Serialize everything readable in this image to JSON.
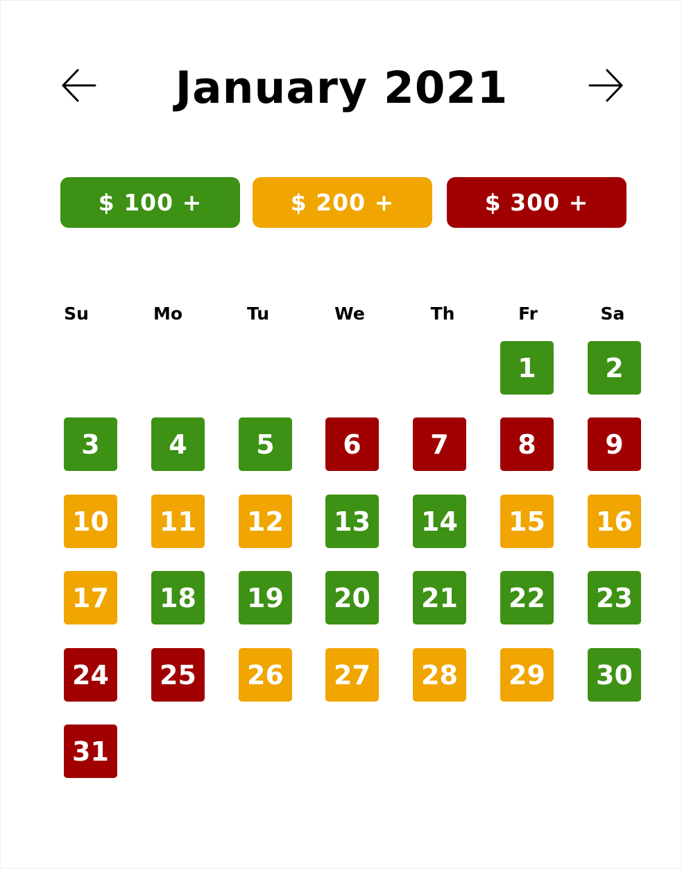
{
  "header": {
    "title": "January 2021",
    "prev_icon": "arrow-left-icon",
    "next_icon": "arrow-right-icon"
  },
  "colors": {
    "green": "#3d9114",
    "orange": "#f0a500",
    "red": "#a00000"
  },
  "legend": [
    {
      "label": "$ 100 +",
      "tier": "green"
    },
    {
      "label": "$ 200 +",
      "tier": "orange"
    },
    {
      "label": "$ 300 +",
      "tier": "red"
    }
  ],
  "weekdays": [
    "Su",
    "Mo",
    "Tu",
    "We",
    "Th",
    "Fr",
    "Sa"
  ],
  "days": [
    {
      "day": "1",
      "tier": "green"
    },
    {
      "day": "2",
      "tier": "green"
    },
    {
      "day": "3",
      "tier": "green"
    },
    {
      "day": "4",
      "tier": "green"
    },
    {
      "day": "5",
      "tier": "green"
    },
    {
      "day": "6",
      "tier": "red"
    },
    {
      "day": "7",
      "tier": "red"
    },
    {
      "day": "8",
      "tier": "red"
    },
    {
      "day": "9",
      "tier": "red"
    },
    {
      "day": "10",
      "tier": "orange"
    },
    {
      "day": "11",
      "tier": "orange"
    },
    {
      "day": "12",
      "tier": "orange"
    },
    {
      "day": "13",
      "tier": "green"
    },
    {
      "day": "14",
      "tier": "green"
    },
    {
      "day": "15",
      "tier": "orange"
    },
    {
      "day": "16",
      "tier": "orange"
    },
    {
      "day": "17",
      "tier": "orange"
    },
    {
      "day": "18",
      "tier": "green"
    },
    {
      "day": "19",
      "tier": "green"
    },
    {
      "day": "20",
      "tier": "green"
    },
    {
      "day": "21",
      "tier": "green"
    },
    {
      "day": "22",
      "tier": "green"
    },
    {
      "day": "23",
      "tier": "green"
    },
    {
      "day": "24",
      "tier": "red"
    },
    {
      "day": "25",
      "tier": "red"
    },
    {
      "day": "26",
      "tier": "orange"
    },
    {
      "day": "27",
      "tier": "orange"
    },
    {
      "day": "28",
      "tier": "orange"
    },
    {
      "day": "29",
      "tier": "orange"
    },
    {
      "day": "30",
      "tier": "green"
    },
    {
      "day": "31",
      "tier": "red"
    }
  ]
}
